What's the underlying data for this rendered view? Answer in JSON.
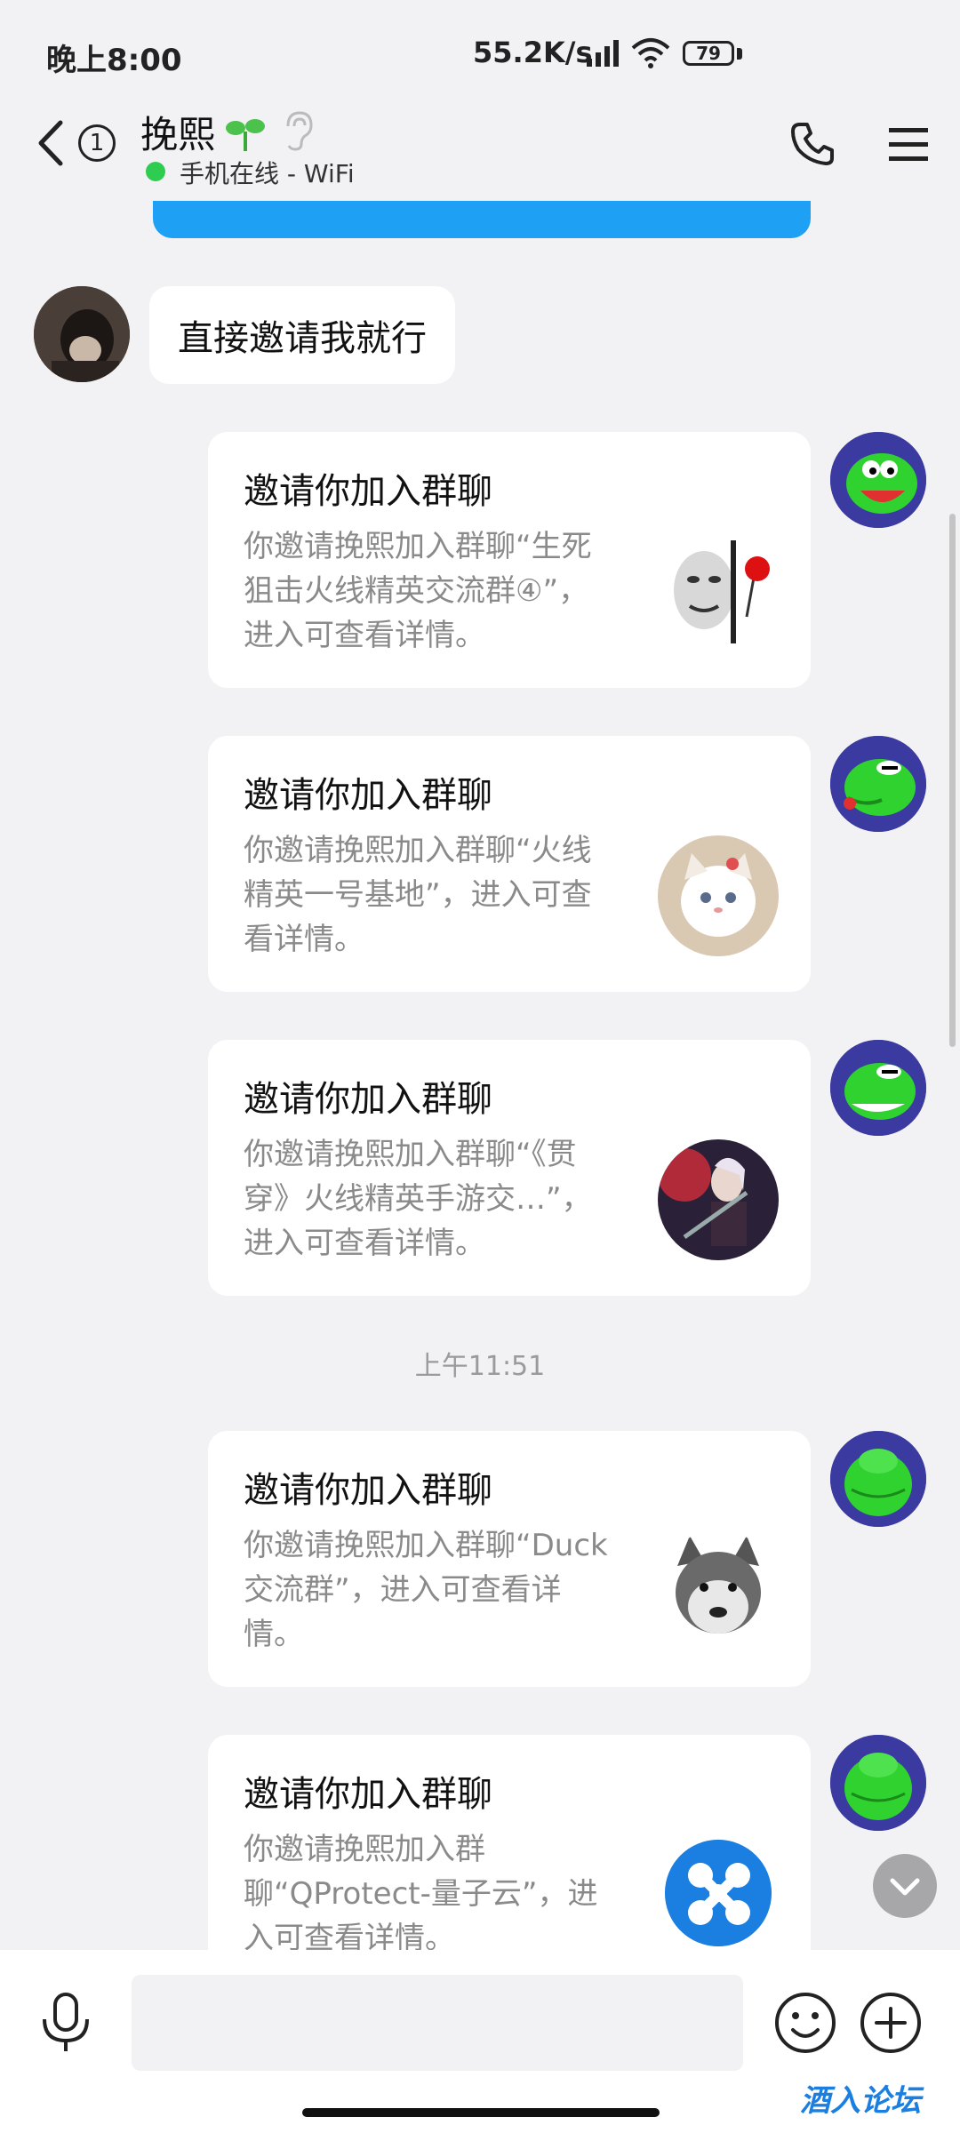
{
  "status_bar": {
    "time": "晚上8:00",
    "net_speed": "55.2K/s",
    "battery": "79"
  },
  "header": {
    "unread_count": "1",
    "contact_name": "挽熙",
    "online_status": "手机在线 - WiFi",
    "icons": [
      "back-arrow-icon",
      "sprout-icon",
      "ear-icon",
      "phone-icon",
      "menu-icon"
    ]
  },
  "colors": {
    "accent": "#1ea0f5",
    "online": "#2ecc50",
    "background": "#f2f2f4"
  },
  "messages": {
    "incoming_text": "直接邀请我就行",
    "invites": [
      {
        "title": "邀请你加入群聊",
        "desc": "你邀请挽熙加入群聊“生死狙击火线精英交流群④”，进入可查看详情。",
        "thumb": "meme-face-rose"
      },
      {
        "title": "邀请你加入群聊",
        "desc": "你邀请挽熙加入群聊“火线精英一号基地”，进入可查看详情。",
        "thumb": "white-cat"
      },
      {
        "title": "邀请你加入群聊",
        "desc": "你邀请挽熙加入群聊“《贯穿》火线精英手游交…”，进入可查看详情。",
        "thumb": "game-character"
      },
      {
        "title": "邀请你加入群聊",
        "desc": "你邀请挽熙加入群聊“Duck交流群”，进入可查看详情。",
        "thumb": "husky-dog"
      },
      {
        "title": "邀请你加入群聊",
        "desc": "你邀请挽熙加入群聊“QProtect-量子云”，进入可查看详情。",
        "thumb": "quantum-logo"
      }
    ],
    "timestamp": "上午11:51"
  },
  "input": {
    "placeholder": ""
  },
  "watermark": "酒入论坛"
}
